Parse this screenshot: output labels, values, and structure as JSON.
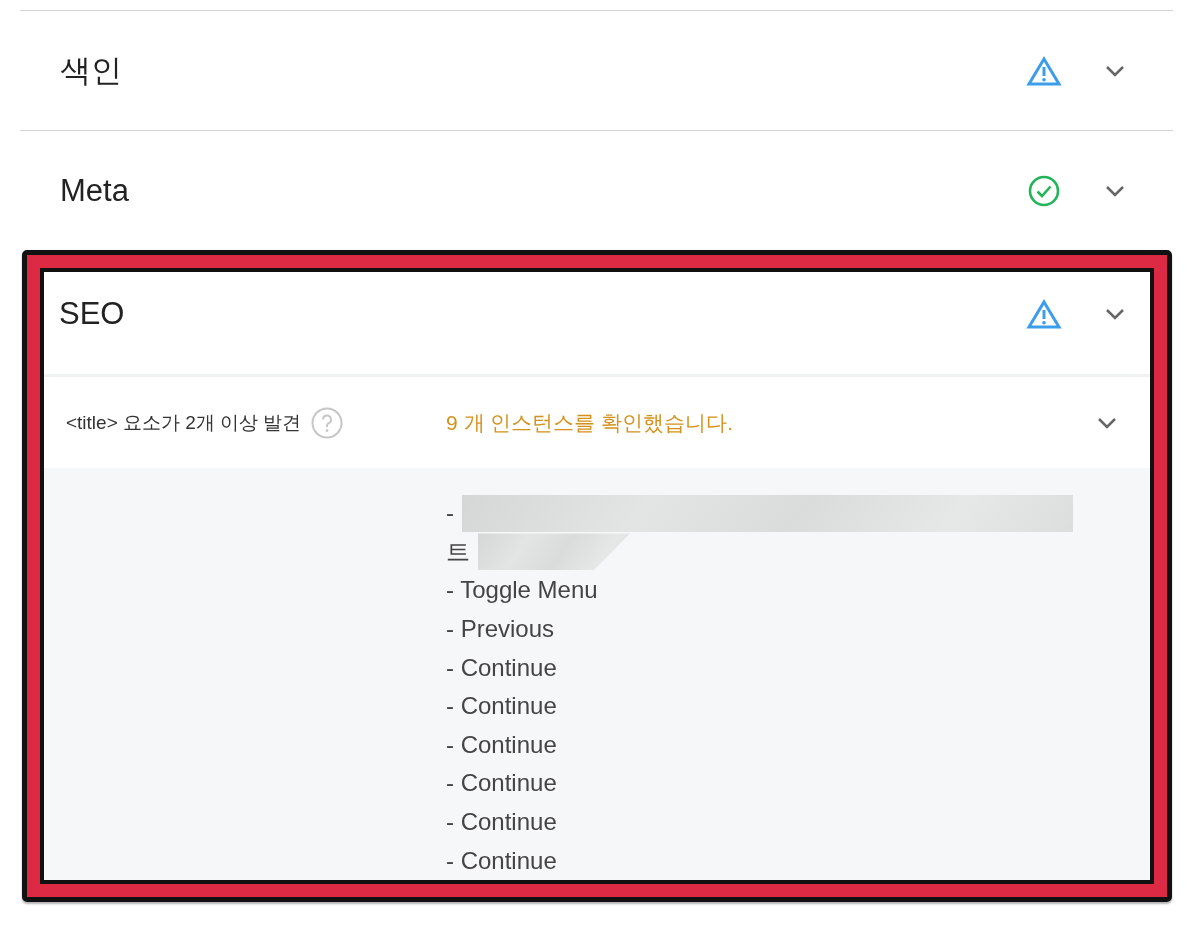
{
  "sections": [
    {
      "title": "색인",
      "kind": "warning",
      "expanded": false,
      "highlighted": false
    },
    {
      "title": "Meta",
      "kind": "pass",
      "expanded": false,
      "highlighted": false
    },
    {
      "title": "SEO",
      "kind": "warning",
      "expanded": true,
      "highlighted": true,
      "checks": [
        {
          "label": "<title> 요소가 2개 이상 발견",
          "result": "9 개 인스턴스를 확인했습니다.",
          "expanded": true,
          "instances": [
            {
              "kind": "redacted",
              "text": "-"
            },
            {
              "kind": "redacted",
              "text": "트"
            },
            {
              "kind": "plain",
              "text": "- Toggle Menu"
            },
            {
              "kind": "plain",
              "text": "- Previous"
            },
            {
              "kind": "plain",
              "text": "- Continue"
            },
            {
              "kind": "plain",
              "text": "- Continue"
            },
            {
              "kind": "plain",
              "text": "- Continue"
            },
            {
              "kind": "plain",
              "text": "- Continue"
            },
            {
              "kind": "plain",
              "text": "- Continue"
            },
            {
              "kind": "plain",
              "text": "- Continue"
            }
          ]
        }
      ]
    }
  ]
}
